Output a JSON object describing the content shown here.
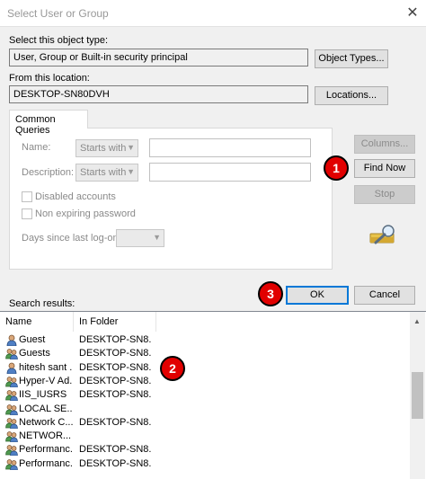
{
  "window": {
    "title": "Select User or Group",
    "close_glyph": "✕"
  },
  "object_type": {
    "label": "Select this object type:",
    "value": "User, Group or Built-in security principal",
    "button": "Object Types..."
  },
  "location": {
    "label": "From this location:",
    "value": "DESKTOP-SN80DVH",
    "button": "Locations..."
  },
  "common_queries": {
    "tab_label": "Common Queries",
    "name_label": "Name:",
    "name_combo": "Starts with",
    "description_label": "Description:",
    "description_combo": "Starts with",
    "disabled_accounts": "Disabled accounts",
    "non_expiring_password": "Non expiring password",
    "days_since_label": "Days since last log-on:"
  },
  "side_buttons": {
    "columns": "Columns...",
    "find_now": "Find Now",
    "stop": "Stop"
  },
  "footer": {
    "ok": "OK",
    "cancel": "Cancel"
  },
  "callouts": {
    "one": "1",
    "two": "2",
    "three": "3"
  },
  "results": {
    "label": "Search results:",
    "columns": [
      "Name",
      "In Folder"
    ],
    "rows": [
      {
        "name": "Guest",
        "folder": "DESKTOP-SN8...",
        "icon": "single-user-icon"
      },
      {
        "name": "Guests",
        "folder": "DESKTOP-SN8...",
        "icon": "group-icon"
      },
      {
        "name": "hitesh sant ...",
        "folder": "DESKTOP-SN8...",
        "icon": "single-user-icon"
      },
      {
        "name": "Hyper-V Ad...",
        "folder": "DESKTOP-SN8...",
        "icon": "group-icon"
      },
      {
        "name": "IIS_IUSRS",
        "folder": "DESKTOP-SN8...",
        "icon": "group-icon"
      },
      {
        "name": "LOCAL SE...",
        "folder": "",
        "icon": "group-icon"
      },
      {
        "name": "Network C...",
        "folder": "DESKTOP-SN8...",
        "icon": "group-icon"
      },
      {
        "name": "NETWOR...",
        "folder": "",
        "icon": "group-icon"
      },
      {
        "name": "Performanc...",
        "folder": "DESKTOP-SN8...",
        "icon": "group-icon"
      },
      {
        "name": "Performanc...",
        "folder": "DESKTOP-SN8...",
        "icon": "group-icon"
      }
    ]
  }
}
